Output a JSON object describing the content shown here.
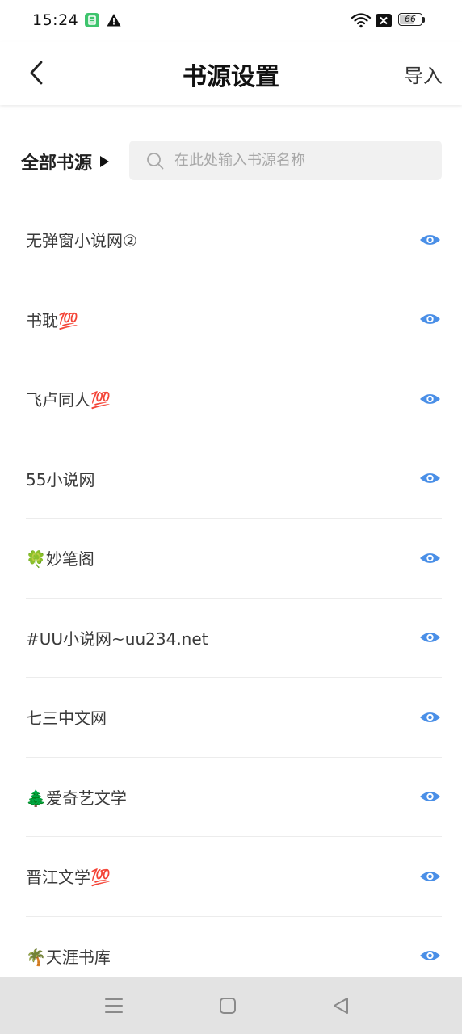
{
  "status_bar": {
    "time": "15:24",
    "battery": "66",
    "battery_level": 0.66
  },
  "header": {
    "title": "书源设置",
    "import_label": "导入"
  },
  "filter": {
    "all_sources_label": "全部书源",
    "search_placeholder": "在此处输入书源名称"
  },
  "sources": [
    {
      "name": "无弹窗小说网②"
    },
    {
      "name": "书耽💯"
    },
    {
      "name": "飞卢同人💯"
    },
    {
      "name": "55小说网"
    },
    {
      "name": "🍀妙笔阁"
    },
    {
      "name": "#UU小说网~uu234.net"
    },
    {
      "name": "七三中文网"
    },
    {
      "name": "🌲爱奇艺文学"
    },
    {
      "name": "晋江文学💯"
    },
    {
      "name": "🌴天涯书库"
    }
  ],
  "colors": {
    "accent": "#4a8fe7",
    "nav_background": "#e3e3e3",
    "search_background": "#f1f1f1"
  },
  "icons": {
    "back": "chevron-left-icon",
    "search": "search-icon",
    "visibility": "eye-icon",
    "filter_toggle": "triangle-right-icon"
  }
}
